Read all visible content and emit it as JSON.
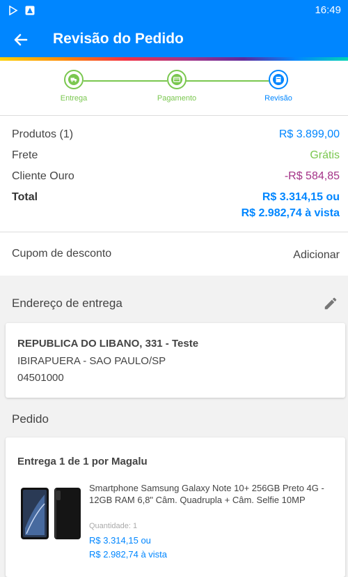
{
  "statusbar": {
    "time": "16:49"
  },
  "header": {
    "title": "Revisão do Pedido"
  },
  "steps": [
    {
      "label": "Entrega"
    },
    {
      "label": "Pagamento"
    },
    {
      "label": "Revisão"
    }
  ],
  "summary": {
    "products_label": "Produtos (1)",
    "products_value": "R$ 3.899,00",
    "shipping_label": "Frete",
    "shipping_value": "Grátis",
    "gold_label": "Cliente Ouro",
    "gold_value": "-R$ 584,85",
    "total_label": "Total",
    "total_value": "R$ 3.314,15 ou",
    "total_cash": "R$ 2.982,74 à vista"
  },
  "coupon": {
    "label": "Cupom de desconto",
    "action": "Adicionar"
  },
  "address": {
    "section_title": "Endereço de entrega",
    "line1": "REPUBLICA DO LIBANO, 331 - Teste",
    "line2": "IBIRAPUERA - SAO PAULO/SP",
    "zip": "04501000"
  },
  "order": {
    "section_title": "Pedido",
    "delivery_title": "Entrega 1 de 1 por Magalu",
    "product_name": "Smartphone Samsung Galaxy Note 10+ 256GB Preto 4G - 12GB RAM 6,8\" Câm. Quadrupla + Câm. Selfie 10MP",
    "quantity": "Quantidade: 1",
    "price": "R$ 3.314,15 ou",
    "price_cash": "R$ 2.982,74 à vista"
  },
  "colors": {
    "primary": "#0086ff",
    "success": "#7ac74f",
    "discount": "#a43287"
  }
}
